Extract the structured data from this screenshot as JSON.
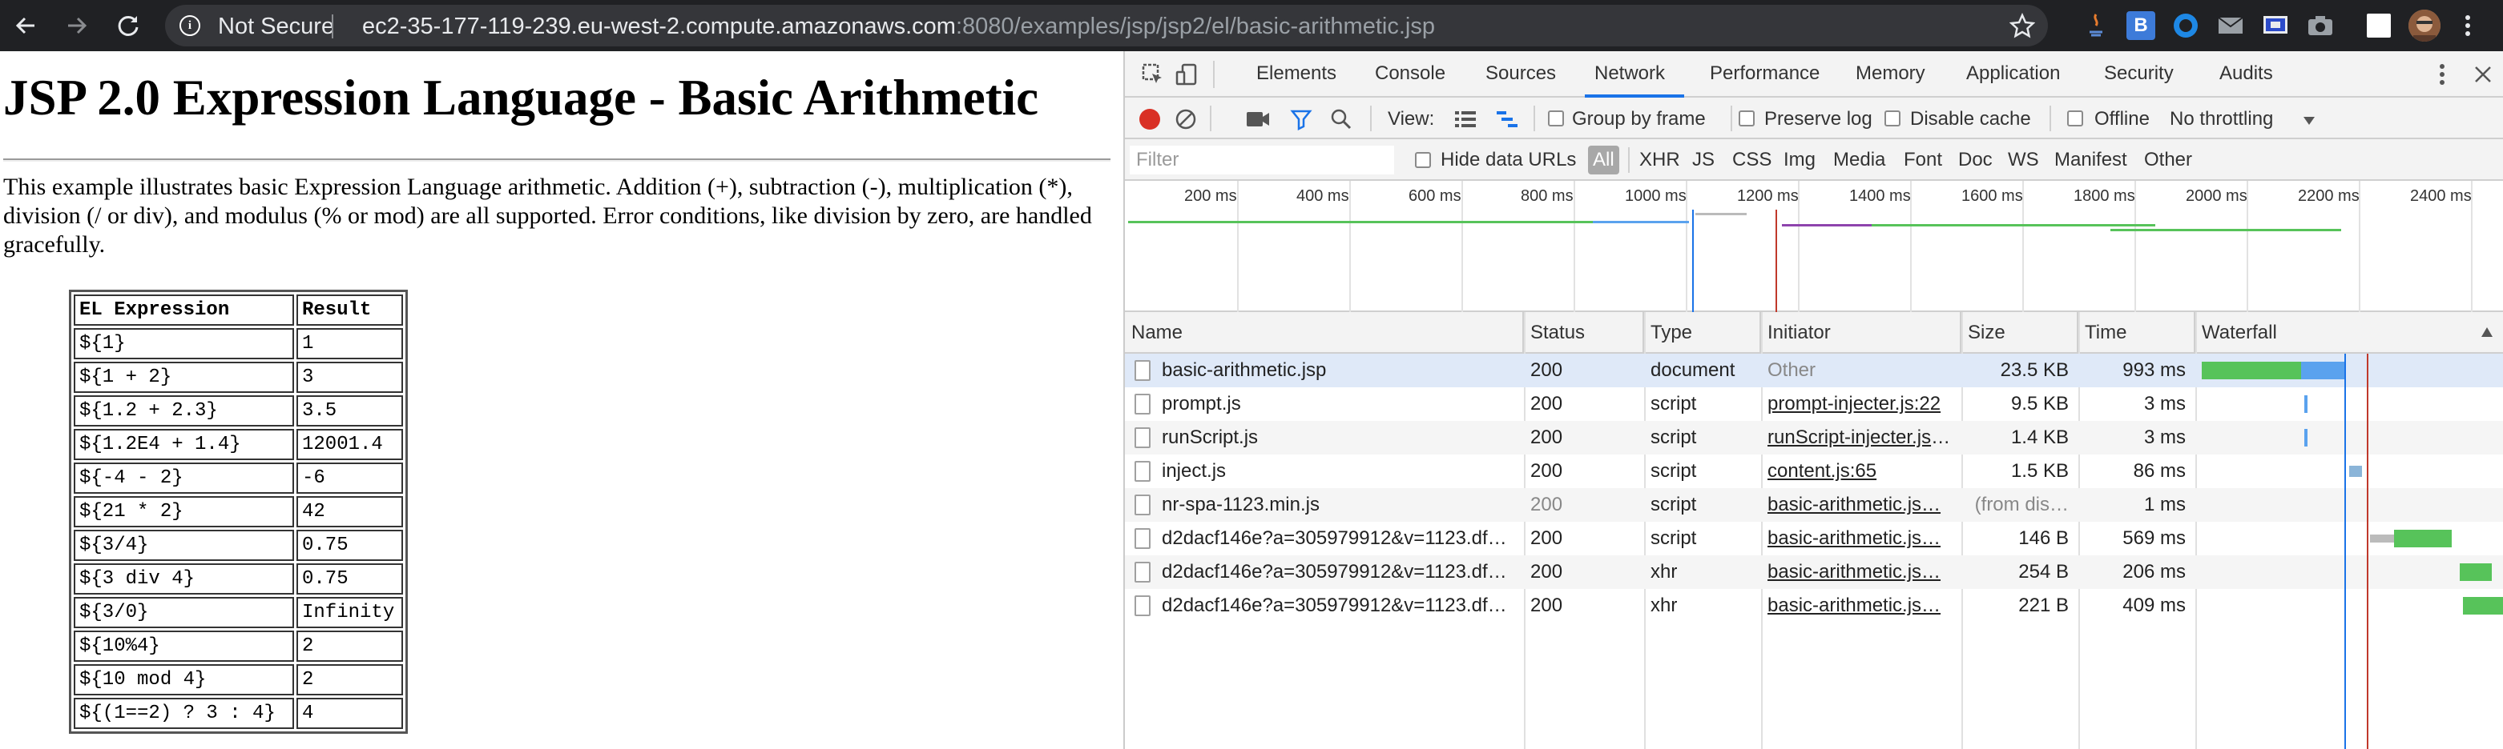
{
  "browser": {
    "security_label": "Not Secure",
    "url_host": "ec2-35-177-119-239.eu-west-2.compute.amazonaws.com",
    "url_path": ":8080/examples/jsp/jsp2/el/basic-arithmetic.jsp"
  },
  "page": {
    "title": "JSP 2.0 Expression Language - Basic Arithmetic",
    "description": "This example illustrates basic Expression Language arithmetic. Addition (+), subtraction (-), multiplication (*), division (/ or div), and modulus (% or mod) are all supported. Error conditions, like division by zero, are handled gracefully.",
    "table": {
      "headers": [
        "EL Expression",
        "Result"
      ],
      "rows": [
        [
          "${1}",
          "1"
        ],
        [
          "${1 + 2}",
          "3"
        ],
        [
          "${1.2 + 2.3}",
          "3.5"
        ],
        [
          "${1.2E4 + 1.4}",
          "12001.4"
        ],
        [
          "${-4 - 2}",
          "-6"
        ],
        [
          "${21 * 2}",
          "42"
        ],
        [
          "${3/4}",
          "0.75"
        ],
        [
          "${3 div 4}",
          "0.75"
        ],
        [
          "${3/0}",
          "Infinity"
        ],
        [
          "${10%4}",
          "2"
        ],
        [
          "${10 mod 4}",
          "2"
        ],
        [
          "${(1==2) ? 3 : 4}",
          "4"
        ]
      ]
    }
  },
  "devtools": {
    "tabs": [
      "Elements",
      "Console",
      "Sources",
      "Network",
      "Performance",
      "Memory",
      "Application",
      "Security",
      "Audits"
    ],
    "active_tab": "Network",
    "toolbar": {
      "view_label": "View:",
      "group_by_frame": "Group by frame",
      "preserve_log": "Preserve log",
      "disable_cache": "Disable cache",
      "offline": "Offline",
      "throttling": "No throttling"
    },
    "filter": {
      "placeholder": "Filter",
      "hide_data_urls": "Hide data URLs",
      "types": [
        "All",
        "XHR",
        "JS",
        "CSS",
        "Img",
        "Media",
        "Font",
        "Doc",
        "WS",
        "Manifest",
        "Other"
      ]
    },
    "overview_ticks": [
      "200 ms",
      "400 ms",
      "600 ms",
      "800 ms",
      "1000 ms",
      "1200 ms",
      "1400 ms",
      "1600 ms",
      "1800 ms",
      "2000 ms",
      "2200 ms",
      "2400 ms"
    ],
    "columns": [
      "Name",
      "Status",
      "Type",
      "Initiator",
      "Size",
      "Time",
      "Waterfall"
    ],
    "requests": [
      {
        "name": "basic-arithmetic.jsp",
        "status": "200",
        "type": "document",
        "initiator": "Other",
        "size": "23.5 KB",
        "time": "993 ms"
      },
      {
        "name": "prompt.js",
        "status": "200",
        "type": "script",
        "initiator": "prompt-injecter.js:22",
        "size": "9.5 KB",
        "time": "3 ms"
      },
      {
        "name": "runScript.js",
        "status": "200",
        "type": "script",
        "initiator": "runScript-injecter.js:…",
        "size": "1.4 KB",
        "time": "3 ms"
      },
      {
        "name": "inject.js",
        "status": "200",
        "type": "script",
        "initiator": "content.js:65",
        "size": "1.5 KB",
        "time": "86 ms"
      },
      {
        "name": "nr-spa-1123.min.js",
        "status": "200",
        "type": "script",
        "initiator": "basic-arithmetic.js…",
        "size": "(from dis…",
        "time": "1 ms"
      },
      {
        "name": "d2dacf146e?a=305979912&v=1123.df…",
        "status": "200",
        "type": "script",
        "initiator": "basic-arithmetic.js…",
        "size": "146 B",
        "time": "569 ms"
      },
      {
        "name": "d2dacf146e?a=305979912&v=1123.df…",
        "status": "200",
        "type": "xhr",
        "initiator": "basic-arithmetic.js…",
        "size": "254 B",
        "time": "206 ms"
      },
      {
        "name": "d2dacf146e?a=305979912&v=1123.df…",
        "status": "200",
        "type": "xhr",
        "initiator": "basic-arithmetic.js…",
        "size": "221 B",
        "time": "409 ms"
      }
    ],
    "colors": {
      "accent": "#1a73e8",
      "bar_green": "#57c35a",
      "bar_blue": "#5aa2ee",
      "record_red": "#d93025"
    }
  }
}
